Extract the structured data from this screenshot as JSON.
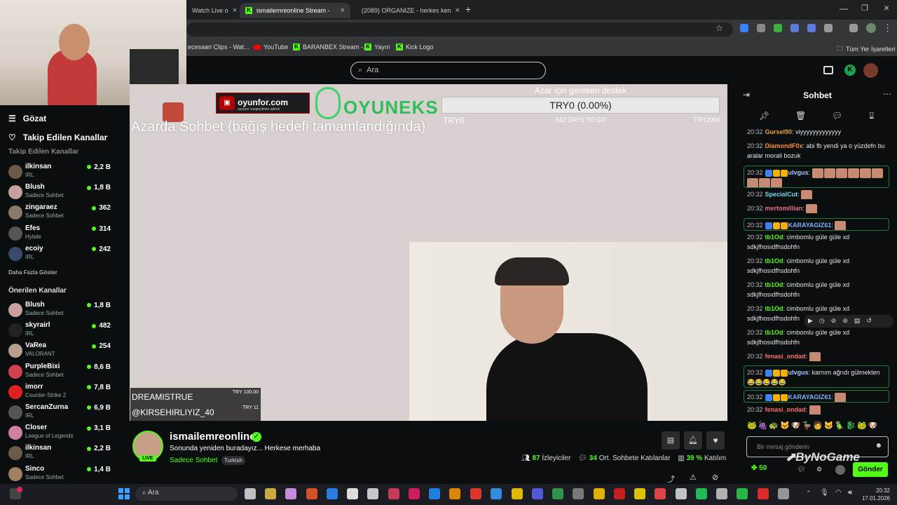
{
  "browser": {
    "tabs": [
      {
        "label": "Watch Live o",
        "active": false
      },
      {
        "label": "ismailemreonline Stream - ",
        "active": true
      },
      {
        "label": "(2089) ORGANIZE - herkes ken",
        "active": false
      }
    ],
    "bookmarks": [
      {
        "label": "ecesaari Clips - Wat...",
        "icon": "kick"
      },
      {
        "label": "YouTube",
        "icon": "youtube"
      },
      {
        "label": "BARANBEX Stream -...",
        "icon": "kick"
      },
      {
        "label": "Yayın",
        "icon": "kick"
      },
      {
        "label": "Kick Logo",
        "icon": "kick"
      }
    ],
    "bookmarks_folder": "Tüm Yer İşaretleri"
  },
  "header": {
    "search_placeholder": "Ara"
  },
  "sidebar": {
    "nav": [
      {
        "label": "Gözat",
        "icon": "browse-icon"
      },
      {
        "label": "Takip Edilen Kanallar",
        "icon": "heart-icon"
      }
    ],
    "followed_heading": "Takip Edilen Kanallar",
    "followed": [
      {
        "name": "ilkinsan",
        "sub": "IRL",
        "viewers": "2,2 B",
        "color": "#6b5a4a"
      },
      {
        "name": "Blush",
        "sub": "Sadece Sohbet",
        "viewers": "1,8 B",
        "color": "#c9a0a0"
      },
      {
        "name": "zingaraez",
        "sub": "Sadece Sohbet",
        "viewers": "362",
        "color": "#8a7a6a"
      },
      {
        "name": "Efes",
        "sub": "Hytale",
        "viewers": "314",
        "color": "#555555"
      },
      {
        "name": "ecoiy",
        "sub": "IRL",
        "viewers": "242",
        "color": "#3a4a6a"
      }
    ],
    "show_more": "Daha Fazla Göster",
    "recommended_heading": "Önerilen Kanallar",
    "recommended": [
      {
        "name": "Blush",
        "sub": "Sadece Sohbet",
        "viewers": "1,8 B",
        "color": "#c9a0a0"
      },
      {
        "name": "skyrairl",
        "sub": "IRL",
        "viewers": "482",
        "color": "#222222"
      },
      {
        "name": "VaRea",
        "sub": "VALORANT",
        "viewers": "254",
        "color": "#b8a090"
      },
      {
        "name": "PurpleBixi",
        "sub": "Sadece Sohbet",
        "viewers": "8,6 B",
        "color": "#d04050"
      },
      {
        "name": "imorr",
        "sub": "Counter-Strike 2",
        "viewers": "7,8 B",
        "color": "#e02020"
      },
      {
        "name": "SercanZurna",
        "sub": "IRL",
        "viewers": "6,9 B",
        "color": "#555555"
      },
      {
        "name": "Closer",
        "sub": "League of Legends",
        "viewers": "3,1 B",
        "color": "#d080a0"
      },
      {
        "name": "ilkinsan",
        "sub": "IRL",
        "viewers": "2,2 B",
        "color": "#6b5a4a"
      },
      {
        "name": "Sinco",
        "sub": "Sadece Sohbet",
        "viewers": "1,4 B",
        "color": "#a08060"
      }
    ]
  },
  "video": {
    "overlay_title": "Azarda Sohbet (bağış hedefi tamamlandığında)",
    "sponsor_1": "oyunfor.com",
    "sponsor_1_sub": "oyunun vazgeçilmez adresi",
    "sponsor_2": "OYUNEKS",
    "goal_label": "Azar için gereken destek",
    "goal_value": "TRY0 (0.00%)",
    "goal_min": "TRY0",
    "goal_days": "242 DAYS TO GO",
    "goal_max": "TRY2000",
    "donor_1": "DREAMISTRUE",
    "donor_1_amount": "TRY 100.00",
    "donor_2": "@KIRSEHIRLIYIZ_40",
    "donor_2_amount": "TRY 11"
  },
  "stream": {
    "channel": "ismailemreonline",
    "title": "Sonunda yeniden buradayız... Herkese merhaba",
    "category": "Sadece Sohbet",
    "tag": "Turkish",
    "live_label": "LIVE",
    "viewers": "87",
    "viewers_label": "İzleyiciler",
    "avg_chat": "34",
    "avg_chat_label": "Ort. Sohbete Katılanlar",
    "participation": "39 %",
    "participation_label": "Katılım"
  },
  "chat": {
    "title": "Sohbet",
    "messages": [
      {
        "time": "20:32",
        "user": "Gursel90",
        "color": "#e8a33c",
        "text": "viyyyyyyyyyyyyy",
        "highlight": false
      },
      {
        "time": "20:32",
        "user": "DiamondF0x",
        "color": "#ff8c3a",
        "text": "abi fb yendi ya o yüzdefn bu aralar morali bozuk",
        "highlight": false
      },
      {
        "time": "20:32",
        "user": "ulvgus",
        "color": "#a7c7ff",
        "text": "",
        "highlight": true
      },
      {
        "time": "20:32",
        "user": "SpecialCut",
        "color": "#7ad8e8",
        "text": "",
        "highlight": false
      },
      {
        "time": "20:32",
        "user": "mertomillian",
        "color": "#e86a8a",
        "text": "",
        "highlight": false
      },
      {
        "time": "20:32",
        "user": "KARAYAGIZ61",
        "color": "#7fb0ff",
        "text": "",
        "highlight": true
      },
      {
        "time": "20:32",
        "user": "tb1Od",
        "color": "#53fc18",
        "text": "cimbomlu güle güle xd sdkjfhosıdfhsdohfn",
        "highlight": false
      },
      {
        "time": "20:32",
        "user": "tb1Od",
        "color": "#53fc18",
        "text": "cimbomlu güle güle xd sdkjfhosıdfhsdohfn",
        "highlight": false
      },
      {
        "time": "20:32",
        "user": "tb1Od",
        "color": "#53fc18",
        "text": "cimbomlu güle güle xd sdkjfhosıdfhsdohfn",
        "highlight": false
      },
      {
        "time": "20:32",
        "user": "tb1Od",
        "color": "#53fc18",
        "text": "cimbomlu güle güle xd sdkjfhosıdfhsdohfn",
        "highlight": false
      },
      {
        "time": "20:32",
        "user": "tb1Od",
        "color": "#53fc18",
        "text": "cimbomlu güle güle xd sdkjfhosıdfhsdohfn",
        "highlight": false
      },
      {
        "time": "20:32",
        "user": "fenasi_ondad",
        "color": "#ff6b6b",
        "text": "",
        "highlight": false
      },
      {
        "time": "20:32",
        "user": "ulvgus",
        "color": "#a7c7ff",
        "text": "karnım ağrıdı gülmekten 😂😂😂😂😂",
        "highlight": true
      },
      {
        "time": "20:32",
        "user": "KARAYAGIZ61",
        "color": "#7fb0ff",
        "text": "",
        "highlight": true
      },
      {
        "time": "20:32",
        "user": "fenasi_ondad",
        "color": "#ff6b6b",
        "text": "",
        "highlight": false
      }
    ],
    "input_placeholder": "Bir mesaj gönderin",
    "points": "50",
    "send_label": "Gönder",
    "watermark": "ByNoGame"
  },
  "taskbar": {
    "search_placeholder": "Ara",
    "time": "20:32",
    "date": "17.01.2026"
  },
  "colors": {
    "accent": "#53fc18",
    "background": "#0b0e0f"
  }
}
